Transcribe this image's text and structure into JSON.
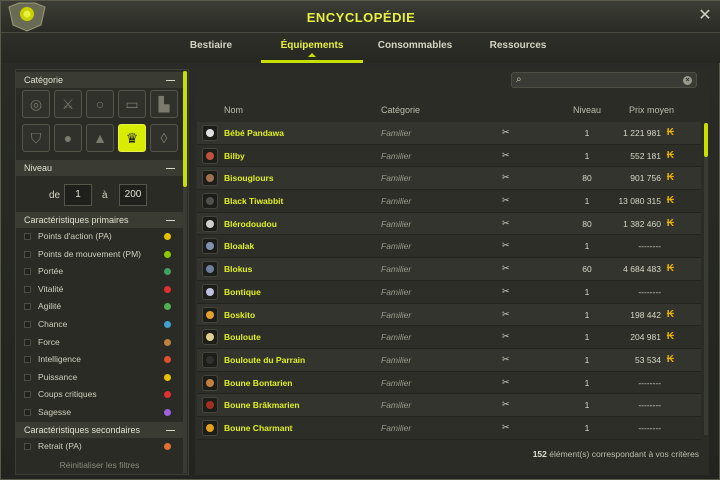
{
  "window": {
    "title": "ENCYCLOPÉDIE"
  },
  "tabs": [
    {
      "label": "Bestiaire",
      "active": false
    },
    {
      "label": "Équipements",
      "active": true
    },
    {
      "label": "Consommables",
      "active": false
    },
    {
      "label": "Ressources",
      "active": false
    }
  ],
  "sidebar": {
    "categorie_label": "Catégorie",
    "categories": [
      {
        "icon": "amulet-icon"
      },
      {
        "icon": "weapon-icon"
      },
      {
        "icon": "ring-icon"
      },
      {
        "icon": "belt-icon"
      },
      {
        "icon": "boots-icon"
      },
      {
        "icon": "shield-icon"
      },
      {
        "icon": "hat-icon"
      },
      {
        "icon": "cloak-icon"
      },
      {
        "icon": "pet-icon",
        "active": true
      },
      {
        "icon": "dofus-icon"
      }
    ],
    "niveau_label": "Niveau",
    "niveau_de": "de",
    "niveau_min": "1",
    "niveau_a": "à",
    "niveau_max": "200",
    "primaires_label": "Caractéristiques primaires",
    "primaires": [
      {
        "label": "Points d'action (PA)",
        "color": "#e8c000"
      },
      {
        "label": "Points de mouvement (PM)",
        "color": "#8cc800"
      },
      {
        "label": "Portée",
        "color": "#40a060"
      },
      {
        "label": "Vitalité",
        "color": "#e03030"
      },
      {
        "label": "Agilité",
        "color": "#50b050"
      },
      {
        "label": "Chance",
        "color": "#40a0d0"
      },
      {
        "label": "Force",
        "color": "#c08040"
      },
      {
        "label": "Intelligence",
        "color": "#e05030"
      },
      {
        "label": "Puissance",
        "color": "#e8c000"
      },
      {
        "label": "Coups critiques",
        "color": "#e03030"
      },
      {
        "label": "Sagesse",
        "color": "#a060e0"
      }
    ],
    "secondaires_label": "Caractéristiques secondaires",
    "secondaires": [
      {
        "label": "Retrait (PA)",
        "color": "#e07030"
      }
    ],
    "reset_label": "Réinitialiser les filtres"
  },
  "search": {
    "placeholder": ""
  },
  "table": {
    "headers": {
      "nom": "Nom",
      "categorie": "Catégorie",
      "niveau": "Niveau",
      "prix": "Prix moyen"
    },
    "rows": [
      {
        "name": "Bébé Pandawa",
        "cat": "Familier",
        "lvl": "1",
        "price": "1 221 981",
        "kama": true,
        "color": "#e0e0e0"
      },
      {
        "name": "Bilby",
        "cat": "Familier",
        "lvl": "1",
        "price": "552 181",
        "kama": true,
        "color": "#c05040"
      },
      {
        "name": "Bisouglours",
        "cat": "Familier",
        "lvl": "80",
        "price": "901 756",
        "kama": true,
        "color": "#a07050"
      },
      {
        "name": "Black Tiwabbit",
        "cat": "Familier",
        "lvl": "1",
        "price": "13 080 315",
        "kama": true,
        "color": "#505050"
      },
      {
        "name": "Blérodoudou",
        "cat": "Familier",
        "lvl": "80",
        "price": "1 382 460",
        "kama": true,
        "color": "#d0d0d0"
      },
      {
        "name": "Bloalak",
        "cat": "Familier",
        "lvl": "1",
        "price": "--------",
        "kama": false,
        "color": "#8090b0"
      },
      {
        "name": "Blokus",
        "cat": "Familier",
        "lvl": "60",
        "price": "4 684 483",
        "kama": true,
        "color": "#7080a0"
      },
      {
        "name": "Bontique",
        "cat": "Familier",
        "lvl": "1",
        "price": "--------",
        "kama": false,
        "color": "#c0c0e0"
      },
      {
        "name": "Boskito",
        "cat": "Familier",
        "lvl": "1",
        "price": "198 442",
        "kama": true,
        "color": "#e0a030"
      },
      {
        "name": "Bouloute",
        "cat": "Familier",
        "lvl": "1",
        "price": "204 981",
        "kama": true,
        "color": "#e0d090"
      },
      {
        "name": "Bouloute du Parrain",
        "cat": "Familier",
        "lvl": "1",
        "price": "53 534",
        "kama": true,
        "color": "#303030"
      },
      {
        "name": "Boune Bontarien",
        "cat": "Familier",
        "lvl": "1",
        "price": "--------",
        "kama": false,
        "color": "#c08040"
      },
      {
        "name": "Boune Brâkmarien",
        "cat": "Familier",
        "lvl": "1",
        "price": "--------",
        "kama": false,
        "color": "#a03020"
      },
      {
        "name": "Boune Charmant",
        "cat": "Familier",
        "lvl": "1",
        "price": "--------",
        "kama": false,
        "color": "#e0a020"
      }
    ]
  },
  "footer": {
    "count": "152",
    "text": " élément(s) correspondant à vos critères"
  }
}
